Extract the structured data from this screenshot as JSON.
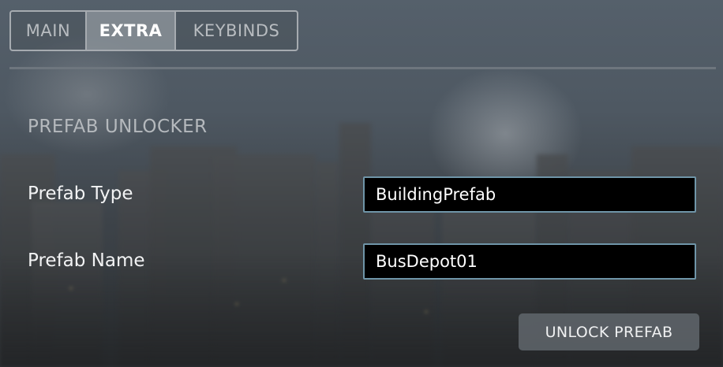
{
  "tabs": {
    "main": "MAIN",
    "extra": "EXTRA",
    "keybinds": "KEYBINDS",
    "active": "EXTRA"
  },
  "section": {
    "title": "PREFAB UNLOCKER"
  },
  "fields": {
    "prefab_type": {
      "label": "Prefab Type",
      "value": "BuildingPrefab"
    },
    "prefab_name": {
      "label": "Prefab Name",
      "value": "BusDepot01"
    }
  },
  "actions": {
    "unlock_label": "UNLOCK PREFAB"
  },
  "colors": {
    "field_border": "#6f95a8",
    "field_bg": "#000000",
    "active_tab_bg": "#aab0b6"
  }
}
